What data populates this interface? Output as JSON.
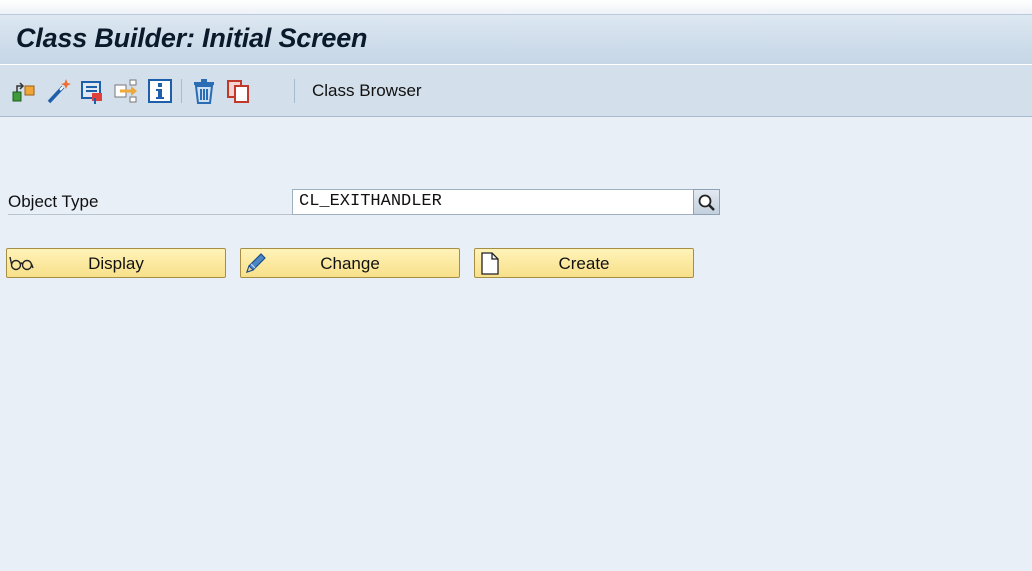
{
  "window": {
    "title": "Class Builder: Initial Screen"
  },
  "toolbar": {
    "icons": [
      "object-hierarchy-icon",
      "magic-wand-icon",
      "test-environment-icon",
      "enhancement-icon",
      "info-icon",
      "trash-icon",
      "copy-icon"
    ],
    "class_browser_label": "Class Browser"
  },
  "form": {
    "object_type_label": "Object Type",
    "object_type_value": "CL_EXITHANDLER"
  },
  "buttons": {
    "display_label": "Display",
    "change_label": "Change",
    "create_label": "Create"
  },
  "colors": {
    "background": "#e8eff6",
    "button_fill": "#f8e08a",
    "toolbar": "#d3dfea"
  }
}
